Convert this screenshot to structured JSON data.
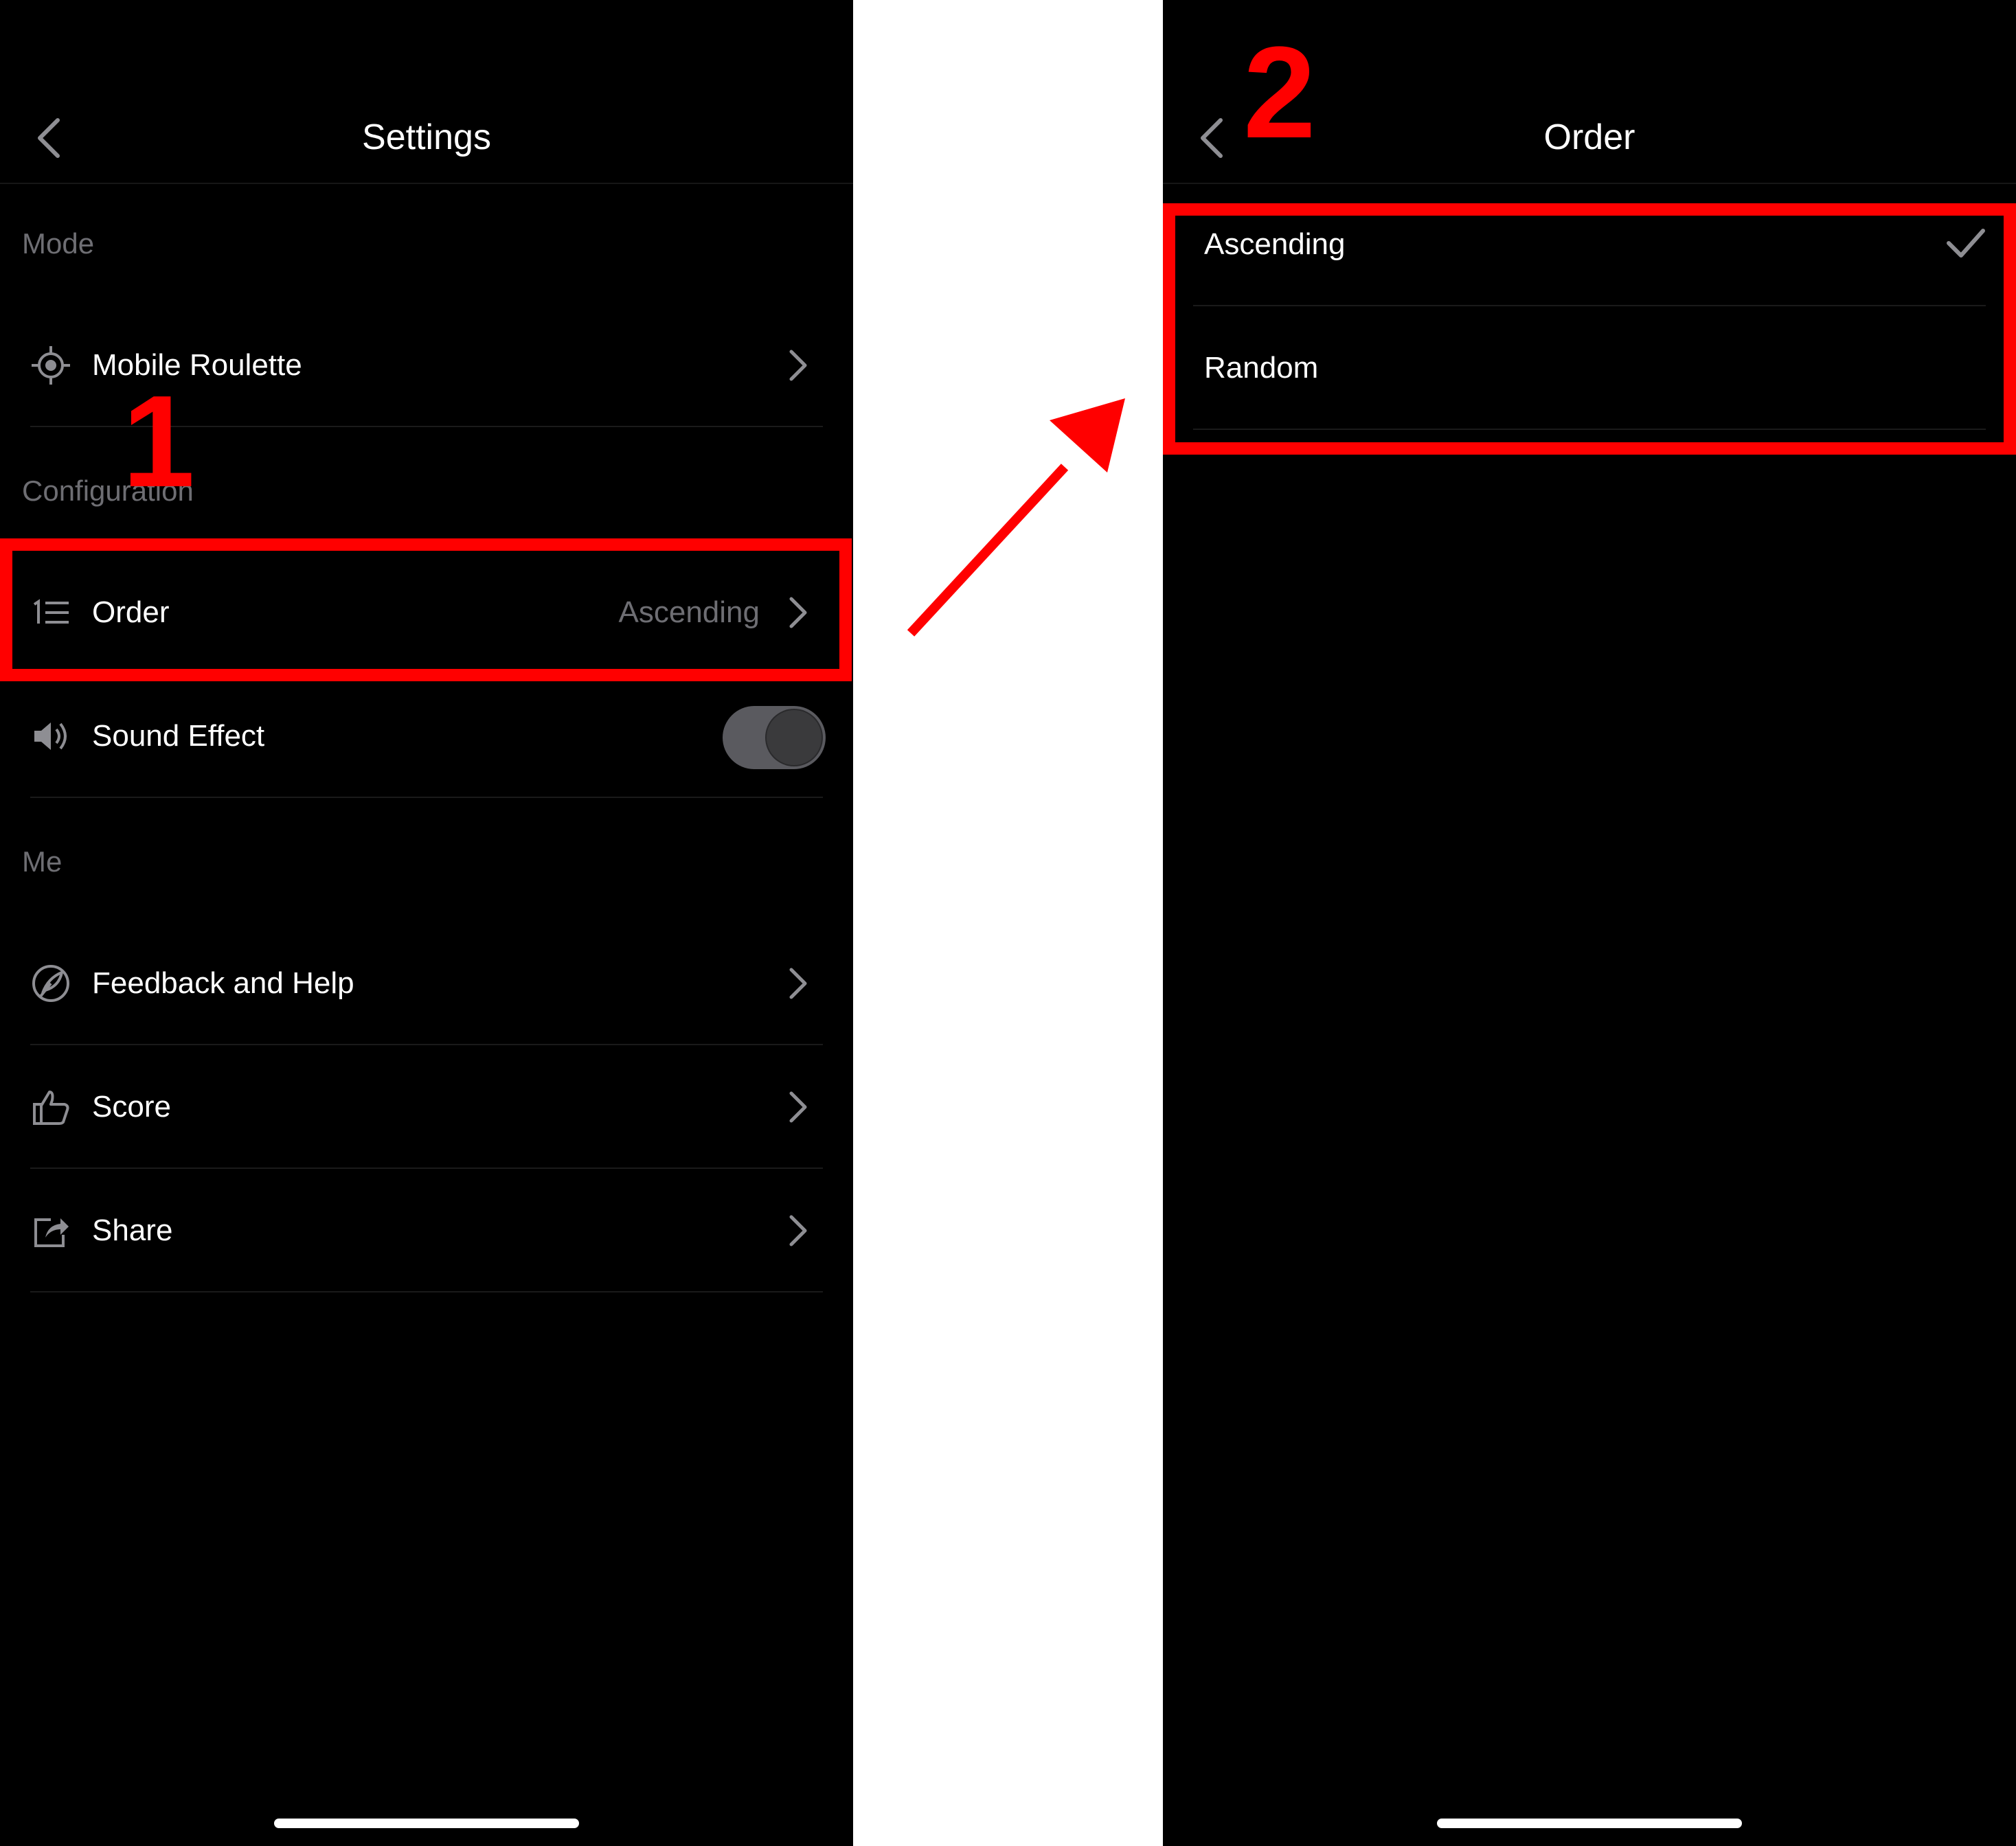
{
  "left_screen": {
    "nav_title": "Settings",
    "sections": {
      "mode": "Mode",
      "configuration": "Configuration",
      "me": "Me"
    },
    "rows": {
      "mobile_roulette": {
        "label": "Mobile Roulette",
        "icon": "target-icon"
      },
      "order": {
        "label": "Order",
        "value": "Ascending",
        "icon": "ordered-list-icon"
      },
      "sound_effect": {
        "label": "Sound Effect",
        "icon": "speaker-icon",
        "toggle_on": false
      },
      "feedback": {
        "label": "Feedback and Help",
        "icon": "feather-pen-icon"
      },
      "score": {
        "label": "Score",
        "icon": "thumbs-up-icon"
      },
      "share": {
        "label": "Share",
        "icon": "share-icon"
      }
    }
  },
  "right_screen": {
    "nav_title": "Order",
    "options": [
      {
        "label": "Ascending",
        "selected": true
      },
      {
        "label": "Random",
        "selected": false
      }
    ]
  },
  "annotations": {
    "step1": "1",
    "step2": "2",
    "highlight_color": "#ff0000"
  }
}
